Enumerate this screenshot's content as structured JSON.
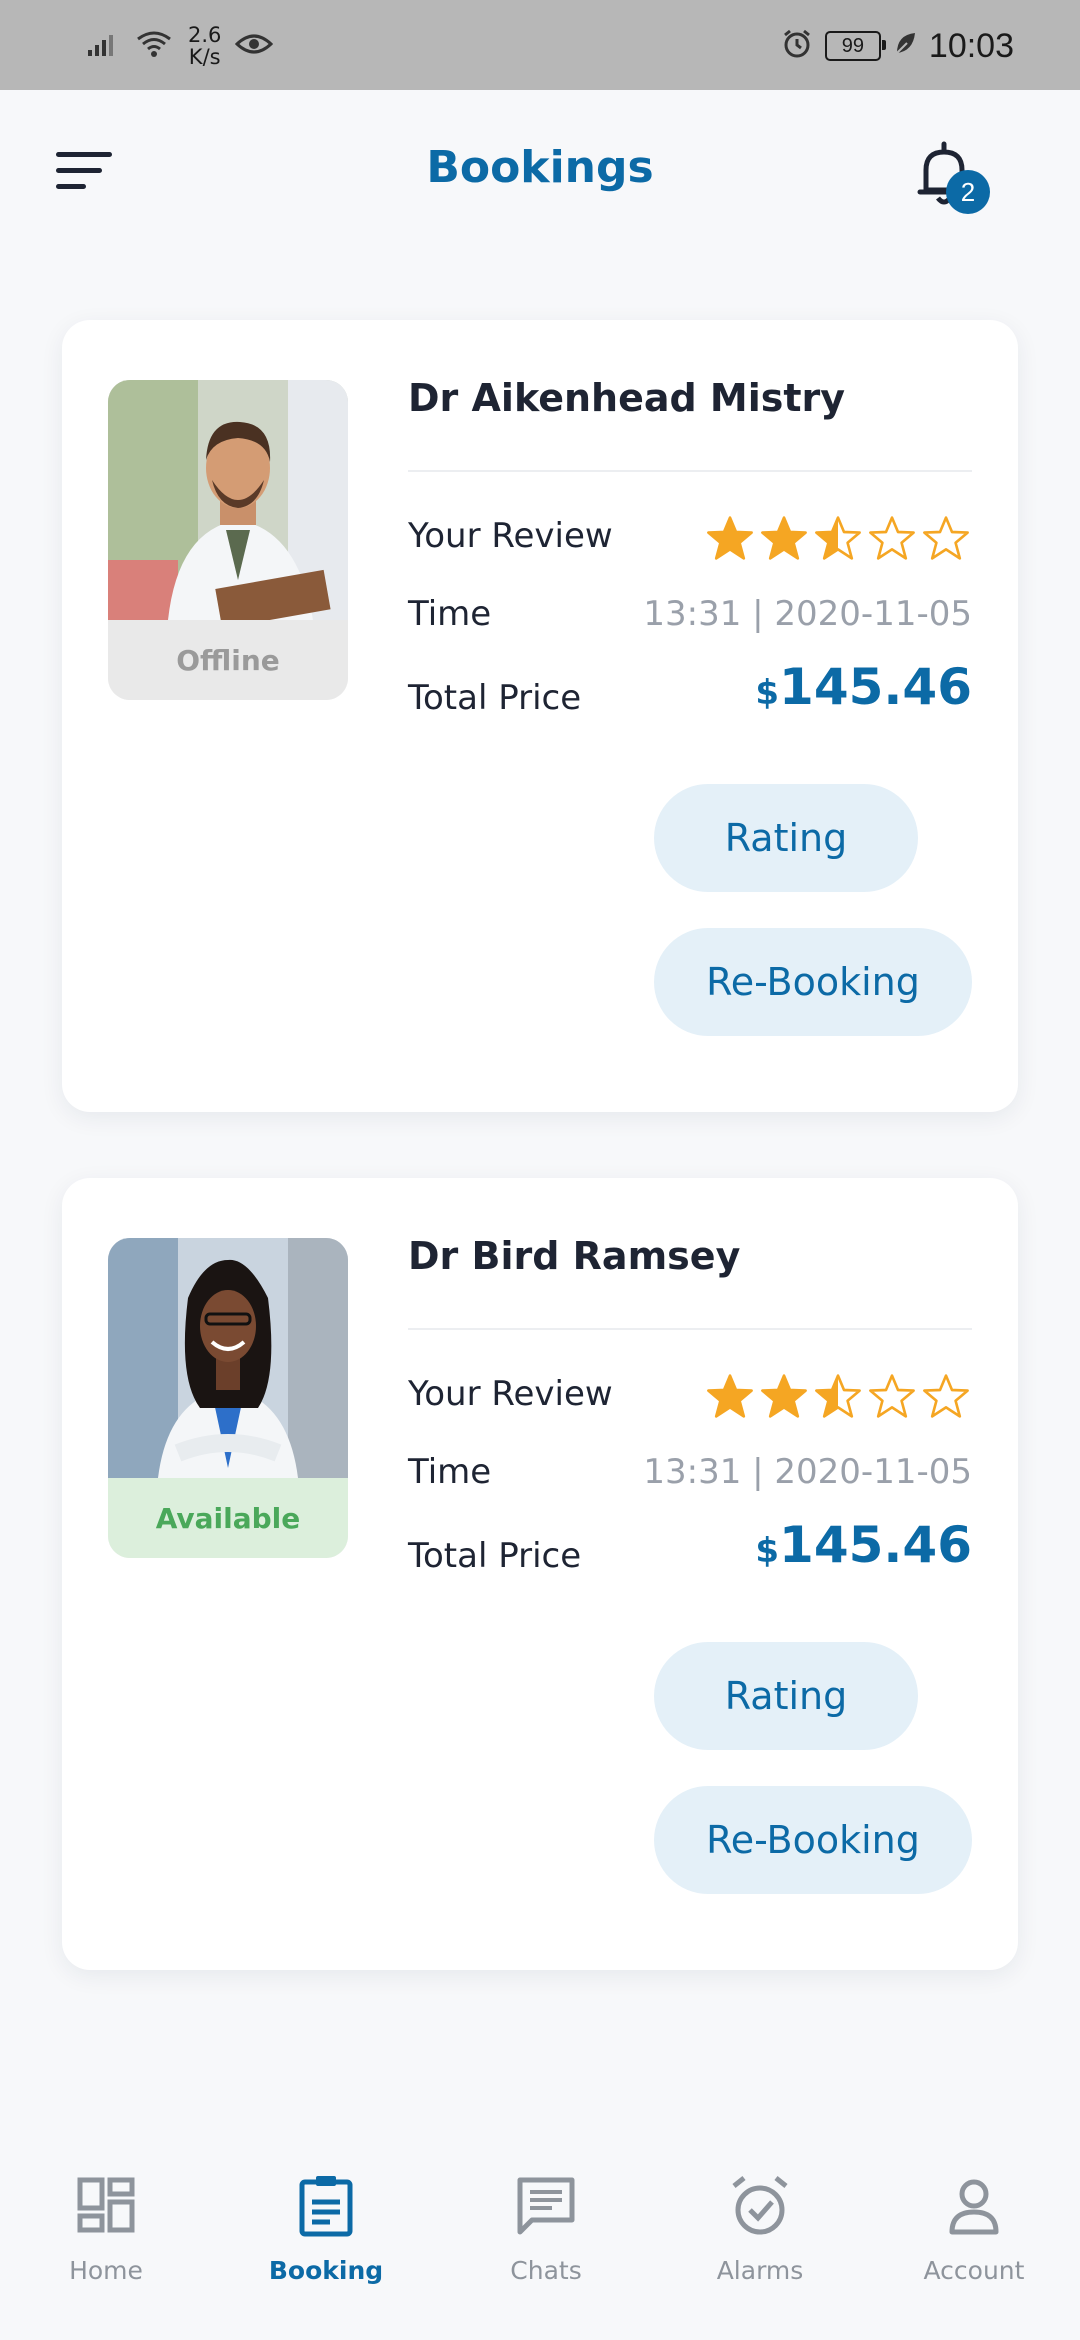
{
  "status_bar": {
    "net_speed_value": "2.6",
    "net_speed_unit": "K/s",
    "battery": "99",
    "time": "10:03"
  },
  "header": {
    "title": "Bookings",
    "notification_count": "2"
  },
  "bookings": [
    {
      "doctor_name": "Dr Aikenhead Mistry",
      "status": "Offline",
      "review_label": "Your Review",
      "rating": 2.5,
      "rating_max": 5,
      "time_label": "Time",
      "time_value": "13:31 | 2020-11-05",
      "price_label": "Total Price",
      "currency": "$",
      "price": "145.46",
      "rating_button": "Rating",
      "rebooking_button": "Re-Booking"
    },
    {
      "doctor_name": "Dr Bird Ramsey",
      "status": "Available",
      "review_label": "Your Review",
      "rating": 2.5,
      "rating_max": 5,
      "time_label": "Time",
      "time_value": "13:31 | 2020-11-05",
      "price_label": "Total Price",
      "currency": "$",
      "price": "145.46",
      "rating_button": "Rating",
      "rebooking_button": "Re-Booking"
    }
  ],
  "bottom_nav": {
    "items": [
      {
        "label": "Home",
        "icon": "dashboard-icon"
      },
      {
        "label": "Booking",
        "icon": "clipboard-icon",
        "active": true
      },
      {
        "label": "Chats",
        "icon": "chat-icon"
      },
      {
        "label": "Alarms",
        "icon": "alarm-icon"
      },
      {
        "label": "Account",
        "icon": "person-icon"
      }
    ]
  },
  "colors": {
    "accent": "#0c6aa6",
    "star": "#f5a623",
    "available": "#4aa85a"
  }
}
